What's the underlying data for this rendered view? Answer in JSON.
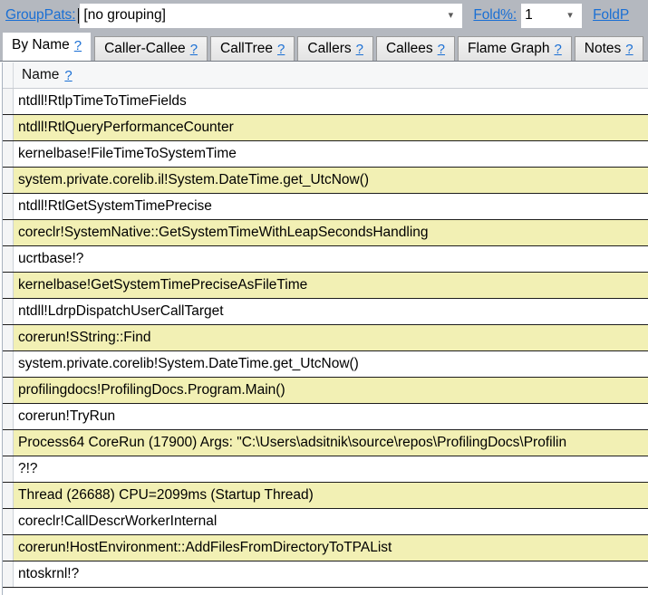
{
  "toolbar": {
    "grouppats_label": "GroupPats:",
    "grouppats_value": "[no grouping]",
    "fold_pct_label": "Fold%:",
    "fold_pct_value": "1",
    "foldpats_label": "FoldP",
    "dropdown_arrow": "chevron-down-icon"
  },
  "tabs": [
    {
      "label": "By Name",
      "help": "?",
      "active": true
    },
    {
      "label": "Caller-Callee",
      "help": "?",
      "active": false
    },
    {
      "label": "CallTree",
      "help": "?",
      "active": false
    },
    {
      "label": "Callers",
      "help": "?",
      "active": false
    },
    {
      "label": "Callees",
      "help": "?",
      "active": false
    },
    {
      "label": "Flame Graph",
      "help": "?",
      "active": false
    },
    {
      "label": "Notes",
      "help": "?",
      "active": false
    }
  ],
  "grid": {
    "columns": [
      {
        "label": "Name",
        "help": "?"
      }
    ],
    "rows": [
      {
        "name": "ntdll!RtlpTimeToTimeFields",
        "highlighted": false
      },
      {
        "name": "ntdll!RtlQueryPerformanceCounter",
        "highlighted": true
      },
      {
        "name": "kernelbase!FileTimeToSystemTime",
        "highlighted": false
      },
      {
        "name": "system.private.corelib.il!System.DateTime.get_UtcNow()",
        "highlighted": true
      },
      {
        "name": "ntdll!RtlGetSystemTimePrecise",
        "highlighted": false
      },
      {
        "name": "coreclr!SystemNative::GetSystemTimeWithLeapSecondsHandling",
        "highlighted": true
      },
      {
        "name": "ucrtbase!?",
        "highlighted": false
      },
      {
        "name": "kernelbase!GetSystemTimePreciseAsFileTime",
        "highlighted": true
      },
      {
        "name": "ntdll!LdrpDispatchUserCallTarget",
        "highlighted": false
      },
      {
        "name": "corerun!SString::Find",
        "highlighted": true
      },
      {
        "name": "system.private.corelib!System.DateTime.get_UtcNow()",
        "highlighted": false
      },
      {
        "name": "profilingdocs!ProfilingDocs.Program.Main()",
        "highlighted": true
      },
      {
        "name": "corerun!TryRun",
        "highlighted": false
      },
      {
        "name": "Process64 CoreRun (17900) Args:  \"C:\\Users\\adsitnik\\source\\repos\\ProfilingDocs\\Profilin",
        "highlighted": true
      },
      {
        "name": "?!?",
        "highlighted": false
      },
      {
        "name": "Thread (26688) CPU=2099ms (Startup Thread)",
        "highlighted": true
      },
      {
        "name": "coreclr!CallDescrWorkerInternal",
        "highlighted": false
      },
      {
        "name": "corerun!HostEnvironment::AddFilesFromDirectoryToTPAList",
        "highlighted": true
      },
      {
        "name": "ntoskrnl!?",
        "highlighted": false
      }
    ]
  },
  "colors": {
    "highlight_row": "#f2f0b4",
    "toolbar_bg": "#b4b8bf",
    "link": "#1a6fd4"
  }
}
